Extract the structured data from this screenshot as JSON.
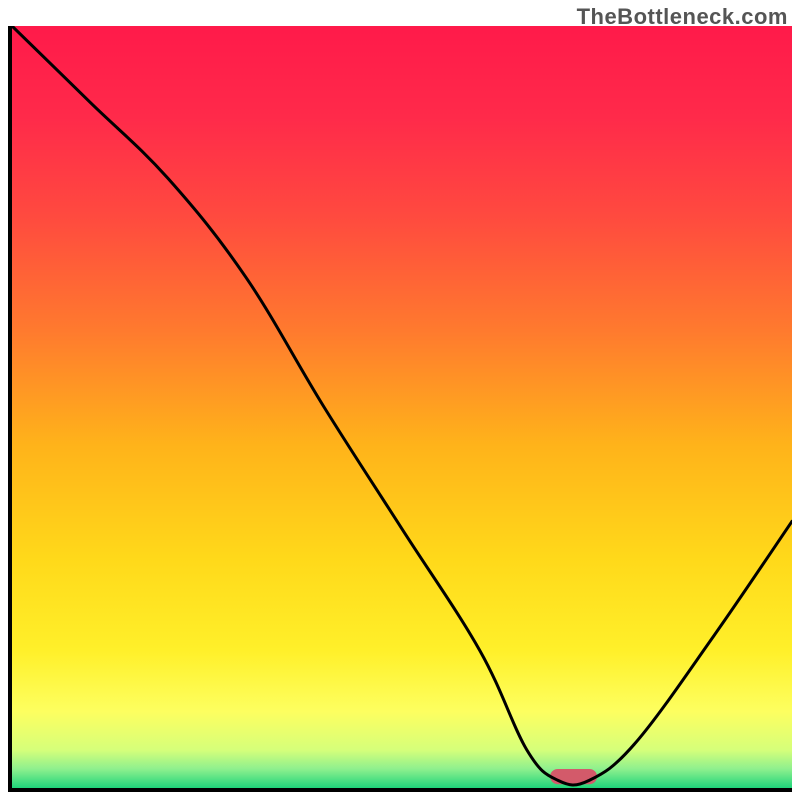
{
  "watermark": "TheBottleneck.com",
  "chart_data": {
    "type": "line",
    "title": "",
    "xlabel": "",
    "ylabel": "",
    "xlim": [
      0,
      100
    ],
    "ylim": [
      0,
      100
    ],
    "grid": false,
    "series": [
      {
        "name": "curve",
        "x": [
          0,
          10,
          20,
          30,
          40,
          50,
          60,
          66,
          70,
          74,
          80,
          90,
          100
        ],
        "y": [
          100,
          90,
          80,
          67,
          50,
          34,
          18,
          5,
          1,
          1,
          6,
          20,
          35
        ],
        "stroke": "#000000",
        "stroke_width": 3
      }
    ],
    "markers": [
      {
        "name": "highlight-pill",
        "x": 72,
        "y": 1.5,
        "color": "#d35a6a",
        "shape": "pill",
        "rx": 3,
        "width_units": 6,
        "height_units": 2
      }
    ],
    "background_gradient": {
      "type": "vertical",
      "stops": [
        {
          "offset": 0.0,
          "color": "#ff1a4a"
        },
        {
          "offset": 0.12,
          "color": "#ff2a4a"
        },
        {
          "offset": 0.25,
          "color": "#ff4a3f"
        },
        {
          "offset": 0.4,
          "color": "#ff7a2e"
        },
        {
          "offset": 0.55,
          "color": "#ffb31a"
        },
        {
          "offset": 0.7,
          "color": "#ffd91a"
        },
        {
          "offset": 0.82,
          "color": "#fff02a"
        },
        {
          "offset": 0.9,
          "color": "#fdff60"
        },
        {
          "offset": 0.95,
          "color": "#d6ff7a"
        },
        {
          "offset": 0.975,
          "color": "#8ef08e"
        },
        {
          "offset": 1.0,
          "color": "#1fd47a"
        }
      ]
    }
  }
}
